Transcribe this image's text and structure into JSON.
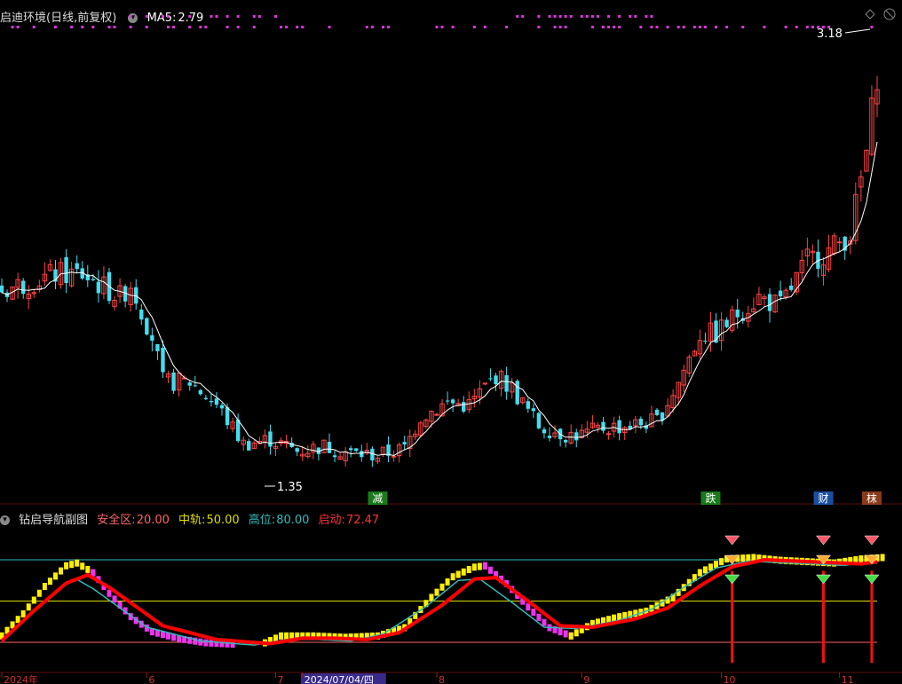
{
  "header_main": {
    "stock": "启迪环境",
    "mode": "(日线,前复权)",
    "ma_label": "MA5:",
    "ma_value": "2.79"
  },
  "header_sub": {
    "indicator": "钻启导航副图",
    "safe_label": "安全区:",
    "safe_value": "20.00",
    "mid_label": "中轨:",
    "mid_value": "50.00",
    "high_label": "高位:",
    "high_value": "80.00",
    "start_label": "启动:",
    "start_value": "72.47"
  },
  "annotations": {
    "max_price": "3.18",
    "min_price": "1.35",
    "tags": [
      {
        "text": "减",
        "color": "#1a7a1a",
        "x_index": 70
      },
      {
        "text": "跌",
        "color": "#1a7a1a",
        "x_index": 132
      },
      {
        "text": "财",
        "color": "#1a4fa0",
        "x_index": 153
      },
      {
        "text": "枺",
        "color": "#8b3a1a",
        "x_index": 162
      }
    ]
  },
  "x_axis": {
    "labels": [
      {
        "text": "2024年",
        "x_index": 0
      },
      {
        "text": "6",
        "x_index": 27
      },
      {
        "text": "7",
        "x_index": 51
      },
      {
        "text": "2024/07/04/四",
        "x_index": 56
      },
      {
        "text": "8",
        "x_index": 81
      },
      {
        "text": "9",
        "x_index": 108
      },
      {
        "text": "10",
        "x_index": 134
      },
      {
        "text": "11",
        "x_index": 156
      }
    ]
  },
  "colors": {
    "up": "#ff4444",
    "down": "#44ddee",
    "ma": "#ffffff",
    "safe_line": "#ff6666",
    "mid_line": "#dddd00",
    "high_line": "#33bbbb",
    "start_line": "#ff0000",
    "yellow_steps": "#ffee00",
    "magenta_steps": "#ee33ee",
    "cyan_curve": "#33bbbb"
  },
  "chart_data": [
    {
      "type": "candlestick",
      "title": "启迪环境 (日线,前复权)",
      "ylim": [
        1.25,
        3.3
      ],
      "ma5_label": "MA5: 2.79",
      "anchors": [
        [
          0,
          2.15
        ],
        [
          10,
          2.22
        ],
        [
          15,
          2.22
        ],
        [
          22,
          2.12
        ],
        [
          24,
          2.18
        ],
        [
          28,
          1.95
        ],
        [
          30,
          1.75
        ],
        [
          35,
          1.75
        ],
        [
          40,
          1.65
        ],
        [
          45,
          1.48
        ],
        [
          50,
          1.5
        ],
        [
          55,
          1.45
        ],
        [
          60,
          1.47
        ],
        [
          65,
          1.44
        ],
        [
          70,
          1.43
        ],
        [
          75,
          1.46
        ],
        [
          78,
          1.6
        ],
        [
          83,
          1.66
        ],
        [
          87,
          1.65
        ],
        [
          92,
          1.78
        ],
        [
          95,
          1.72
        ],
        [
          100,
          1.56
        ],
        [
          105,
          1.52
        ],
        [
          108,
          1.52
        ],
        [
          112,
          1.55
        ],
        [
          117,
          1.56
        ],
        [
          122,
          1.58
        ],
        [
          126,
          1.75
        ],
        [
          130,
          1.96
        ],
        [
          133,
          1.96
        ],
        [
          137,
          2.05
        ],
        [
          141,
          2.12
        ],
        [
          145,
          2.08
        ],
        [
          150,
          2.28
        ],
        [
          154,
          2.32
        ],
        [
          158,
          2.4
        ],
        [
          161,
          2.75
        ],
        [
          163,
          3.1
        ]
      ],
      "count": 164
    },
    {
      "type": "line",
      "title": "钻启导航副图",
      "ylim": [
        0,
        100
      ],
      "levels": [
        {
          "name": "安全区",
          "value": 20
        },
        {
          "name": "中轨",
          "value": 50
        },
        {
          "name": "高位",
          "value": 80
        },
        {
          "name": "启动",
          "value": 72.47
        }
      ],
      "yellow_anchors": [
        [
          0,
          24
        ],
        [
          4,
          40
        ],
        [
          8,
          60
        ],
        [
          12,
          75
        ],
        [
          14,
          77
        ],
        [
          17,
          70
        ]
      ],
      "magenta_anchors": [
        [
          17,
          70
        ],
        [
          20,
          55
        ],
        [
          24,
          38
        ],
        [
          28,
          27
        ],
        [
          33,
          22
        ],
        [
          38,
          19
        ],
        [
          43,
          18
        ]
      ],
      "yellow2_anchors": [
        [
          49,
          19
        ],
        [
          52,
          24
        ],
        [
          58,
          24
        ],
        [
          64,
          23
        ],
        [
          70,
          24
        ],
        [
          75,
          30
        ],
        [
          80,
          52
        ],
        [
          84,
          67
        ],
        [
          88,
          74
        ],
        [
          90,
          75
        ]
      ],
      "magenta2_anchors": [
        [
          90,
          75
        ],
        [
          94,
          62
        ],
        [
          98,
          45
        ],
        [
          102,
          30
        ],
        [
          106,
          24
        ]
      ],
      "yellow3_anchors": [
        [
          106,
          24
        ],
        [
          110,
          33
        ],
        [
          115,
          38
        ],
        [
          120,
          42
        ],
        [
          125,
          52
        ],
        [
          130,
          70
        ],
        [
          135,
          80
        ],
        [
          140,
          81
        ],
        [
          145,
          79
        ],
        [
          150,
          78
        ],
        [
          155,
          77
        ],
        [
          160,
          80
        ],
        [
          164,
          81
        ]
      ],
      "red_anchors": [
        [
          0,
          21
        ],
        [
          6,
          43
        ],
        [
          12,
          63
        ],
        [
          16,
          69
        ],
        [
          20,
          60
        ],
        [
          30,
          32
        ],
        [
          40,
          22
        ],
        [
          50,
          19
        ],
        [
          56,
          23
        ],
        [
          62,
          23
        ],
        [
          68,
          22
        ],
        [
          74,
          27
        ],
        [
          82,
          47
        ],
        [
          88,
          66
        ],
        [
          92,
          67
        ],
        [
          98,
          50
        ],
        [
          104,
          32
        ],
        [
          110,
          31
        ],
        [
          118,
          37
        ],
        [
          124,
          45
        ],
        [
          130,
          61
        ],
        [
          136,
          75
        ],
        [
          142,
          80
        ],
        [
          148,
          79
        ],
        [
          154,
          78
        ],
        [
          160,
          77
        ],
        [
          164,
          79
        ]
      ],
      "signal_markers": [
        136,
        153,
        162
      ]
    }
  ]
}
